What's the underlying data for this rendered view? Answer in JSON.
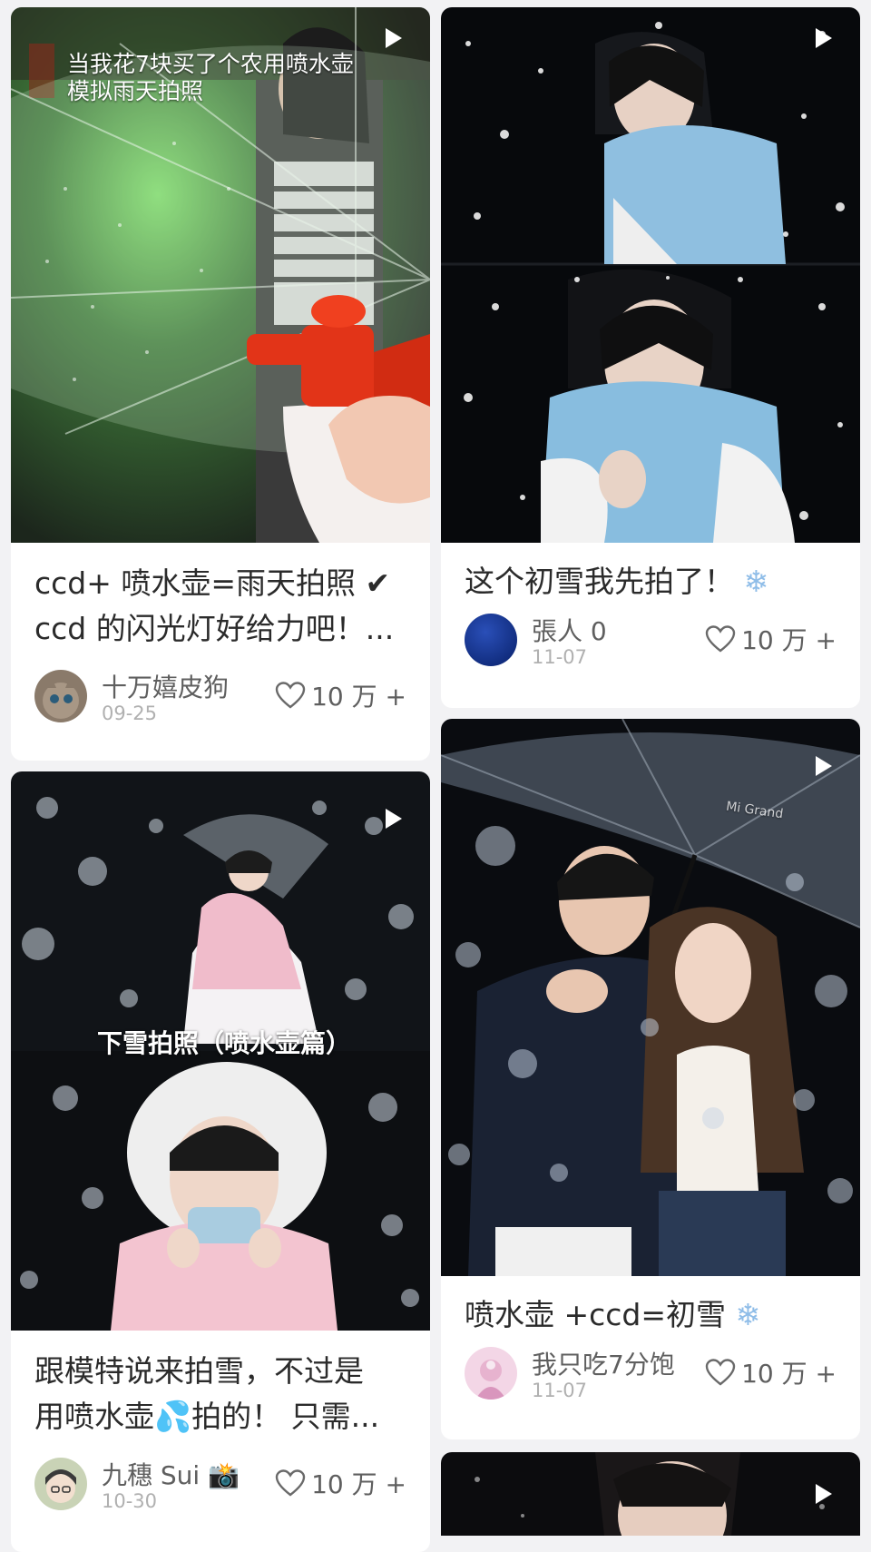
{
  "feed": {
    "left": [
      {
        "overlay_lines": [
          "当我花7块买了个农用喷水壶",
          "模拟雨天拍照"
        ],
        "title_line1": "ccd+ 喷水壶=雨天拍照",
        "title_check": "✔",
        "title_line2": "ccd 的闪光灯好给力吧！...",
        "author": "十万嬉皮狗",
        "date": "09-25",
        "likes": "10 万 +"
      },
      {
        "overlay_text": "下雪拍照（喷水壶篇）",
        "title_line1": "跟模特说来拍雪，不过是",
        "title_line2_a": "用喷水壶",
        "title_line2_emoji": "💦",
        "title_line2_b": "拍的！ 只需...",
        "author": "九穗 Sui",
        "author_emoji": "📸",
        "date": "10-30",
        "likes": "10 万 +"
      }
    ],
    "right": [
      {
        "title": "这个初雪我先拍了！",
        "title_emoji": "❄",
        "author": "張人 0",
        "date": "11-07",
        "likes": "10 万 +"
      },
      {
        "umbrella_text": "Mi Grand",
        "title": "喷水壶 +ccd=初雪",
        "title_emoji": "❄",
        "author": "我只吃7分饱",
        "date": "11-07",
        "likes": "10 万 +"
      }
    ]
  },
  "icons": {
    "play": "play-icon",
    "like": "heart-outline-icon"
  },
  "colors": {
    "background": "#f2f2f4",
    "card": "#ffffff",
    "text": "#2b2b2b",
    "meta": "#5f5f5f",
    "date": "#b0b0b0"
  }
}
